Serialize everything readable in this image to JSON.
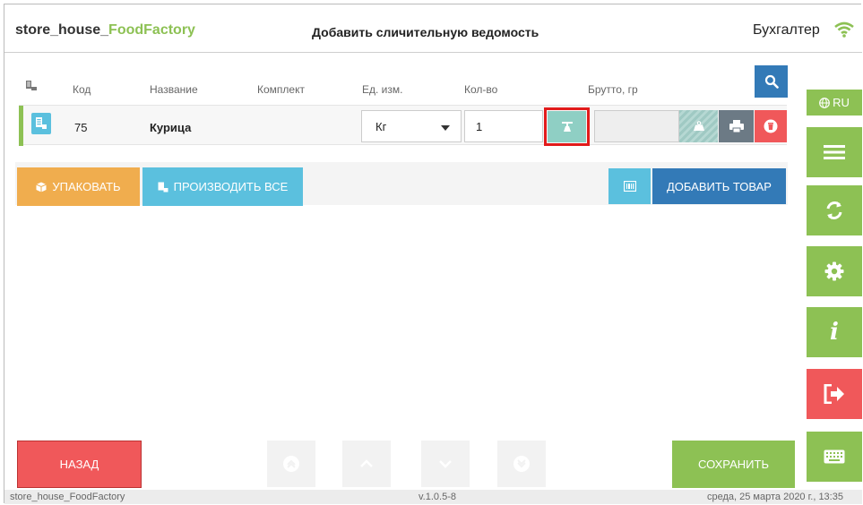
{
  "header": {
    "brand_prefix": "store_house_",
    "brand_accent": "FoodFactory",
    "title": "Добавить сличительную ведомость",
    "user": "Бухгалтер"
  },
  "table": {
    "columns": [
      "Код",
      "Название",
      "Комплект",
      "Ед. изм.",
      "Кол-во",
      "Брутто, гр"
    ],
    "rows": [
      {
        "code": "75",
        "name": "Курица",
        "unit": "Кг",
        "qty": "1",
        "gross": ""
      }
    ]
  },
  "actions": {
    "pack_label": "УПАКОВАТЬ",
    "produce_all_label": "ПРОИЗВОДИТЬ ВСЕ",
    "add_item_label": "ДОБАВИТЬ ТОВАР"
  },
  "sidebar": {
    "lang": "RU",
    "info_glyph": "i"
  },
  "footer": {
    "back_label": "НАЗАД",
    "save_label": "СОХРАНИТЬ"
  },
  "statusbar": {
    "app": "store_house_FoodFactory",
    "version": "v.1.0.5-8",
    "datetime": "среда, 25 марта 2020 г., 13:35"
  },
  "colors": {
    "green": "#8dc154",
    "blue": "#337ab7",
    "cyan": "#5bc0de",
    "orange": "#f0ad4e",
    "red": "#f0585a",
    "teal": "#8fcfc4",
    "highlight": "#e21b1b"
  }
}
